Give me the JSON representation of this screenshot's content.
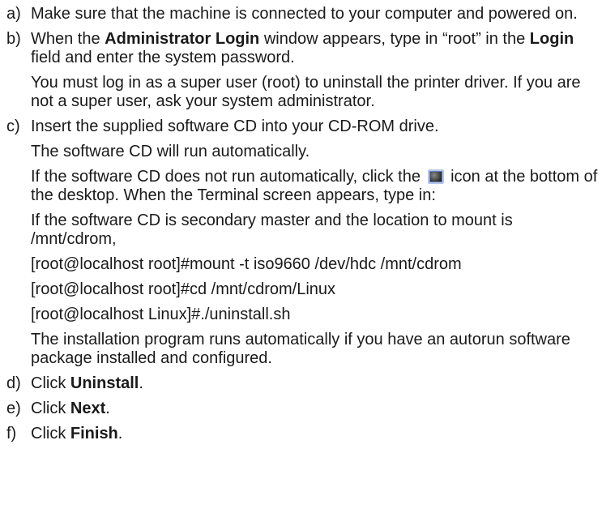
{
  "steps": [
    {
      "marker": "a)",
      "text": "Make sure that the machine is connected to your computer and powered on."
    },
    {
      "marker": "b)",
      "pre": "When the ",
      "bold1": "Administrator Login",
      "mid": " window appears, type in “root” in the ",
      "bold2": "Login",
      "post": " field and enter the system password.",
      "note": "You must log in as a super user (root) to uninstall the printer driver. If you are not a super user, ask your system administrator."
    },
    {
      "marker": "c)",
      "text": "Insert the supplied software CD into your CD-ROM drive.",
      "auto_run": "The software CD will run automatically.",
      "if_not_pre": "If the software CD does not run automatically, click the ",
      "if_not_post": " icon at the bottom of the desktop. When the Terminal screen appears, type in:",
      "icon": "terminal-icon",
      "secondary": "If the software CD is secondary master and the location to mount is /mnt/cdrom,",
      "commands": [
        "[root@localhost root]#mount -t iso9660 /dev/hdc /mnt/cdrom",
        "[root@localhost root]#cd /mnt/cdrom/Linux",
        "[root@localhost Linux]#./uninstall.sh"
      ],
      "autorun_note": "The installation program runs automatically if you have an autorun software package installed and configured."
    },
    {
      "marker": "d)",
      "pre": "Click ",
      "bold": "Uninstall",
      "post": "."
    },
    {
      "marker": "e)",
      "pre": "Click ",
      "bold": "Next",
      "post": "."
    },
    {
      "marker": "f)",
      "pre": "Click ",
      "bold": "Finish",
      "post": "."
    }
  ]
}
